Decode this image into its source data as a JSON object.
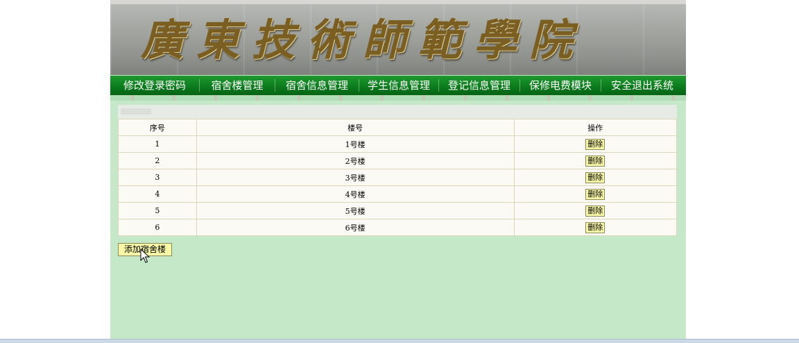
{
  "banner": {
    "title": "廣東技術師範學院"
  },
  "nav": {
    "items": [
      {
        "id": "change-password",
        "label": "修改登录密码"
      },
      {
        "id": "building-management",
        "label": "宿舍楼管理"
      },
      {
        "id": "dorm-info-management",
        "label": "宿舍信息管理"
      },
      {
        "id": "student-info-management",
        "label": "学生信息管理"
      },
      {
        "id": "registration-info-management",
        "label": "登记信息管理"
      },
      {
        "id": "repair-electricity-module",
        "label": "保修电费模块"
      },
      {
        "id": "logout",
        "label": "安全退出系统"
      }
    ]
  },
  "table": {
    "headers": {
      "index": "序号",
      "building": "楼号",
      "action": "操作"
    },
    "rows": [
      {
        "index": "1",
        "building": "1号楼",
        "action": "删除"
      },
      {
        "index": "2",
        "building": "2号楼",
        "action": "删除"
      },
      {
        "index": "3",
        "building": "3号楼",
        "action": "删除"
      },
      {
        "index": "4",
        "building": "4号楼",
        "action": "删除"
      },
      {
        "index": "5",
        "building": "5号楼",
        "action": "删除"
      },
      {
        "index": "6",
        "building": "6号楼",
        "action": "删除"
      }
    ]
  },
  "add_button": {
    "label": "添加宿舍楼"
  },
  "colors": {
    "nav_green": "#0c7c1d",
    "content_bg": "#c4e8c8",
    "button_bg": "#f9f8a8",
    "table_border": "#dcd6b8"
  }
}
